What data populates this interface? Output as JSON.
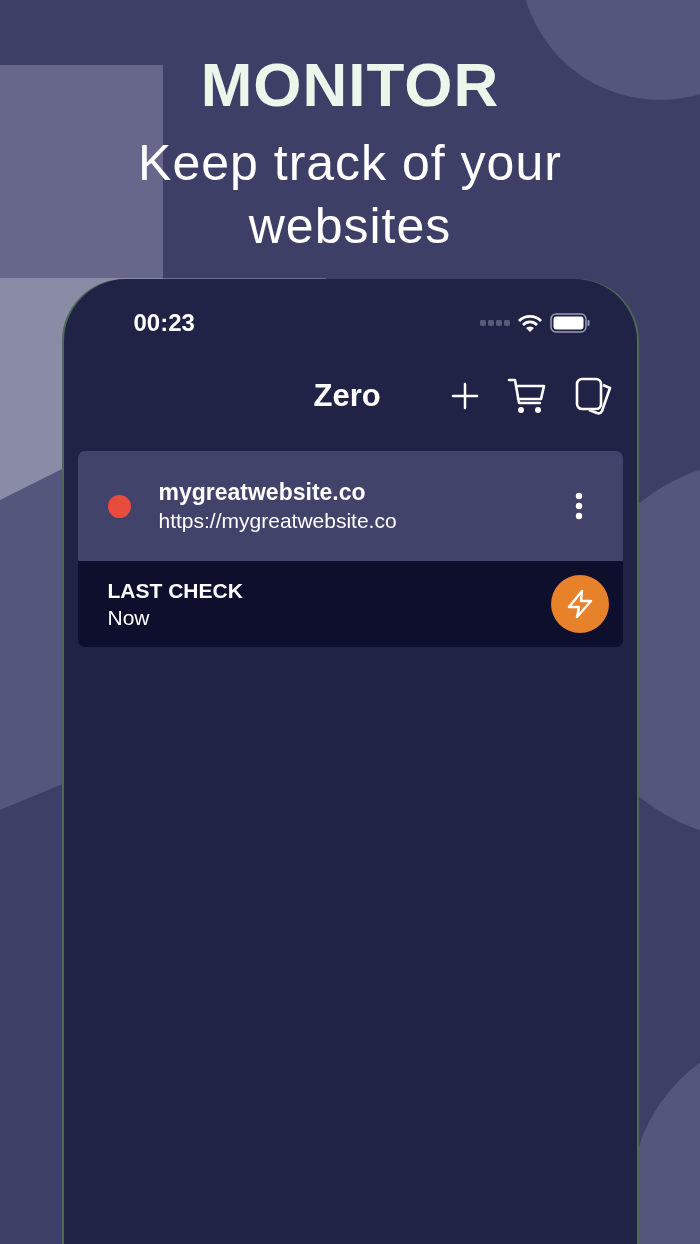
{
  "headline": "MONITOR",
  "subtitle": "Keep track of your websites",
  "phone": {
    "status_bar": {
      "time": "00:23"
    },
    "nav": {
      "title": "Zero"
    },
    "sites": [
      {
        "name": "mygreatwebsite.co",
        "url": "https://mygreatwebsite.co",
        "color": "#e84c3d",
        "check_label": "LAST CHECK",
        "check_value": "Now"
      }
    ]
  }
}
